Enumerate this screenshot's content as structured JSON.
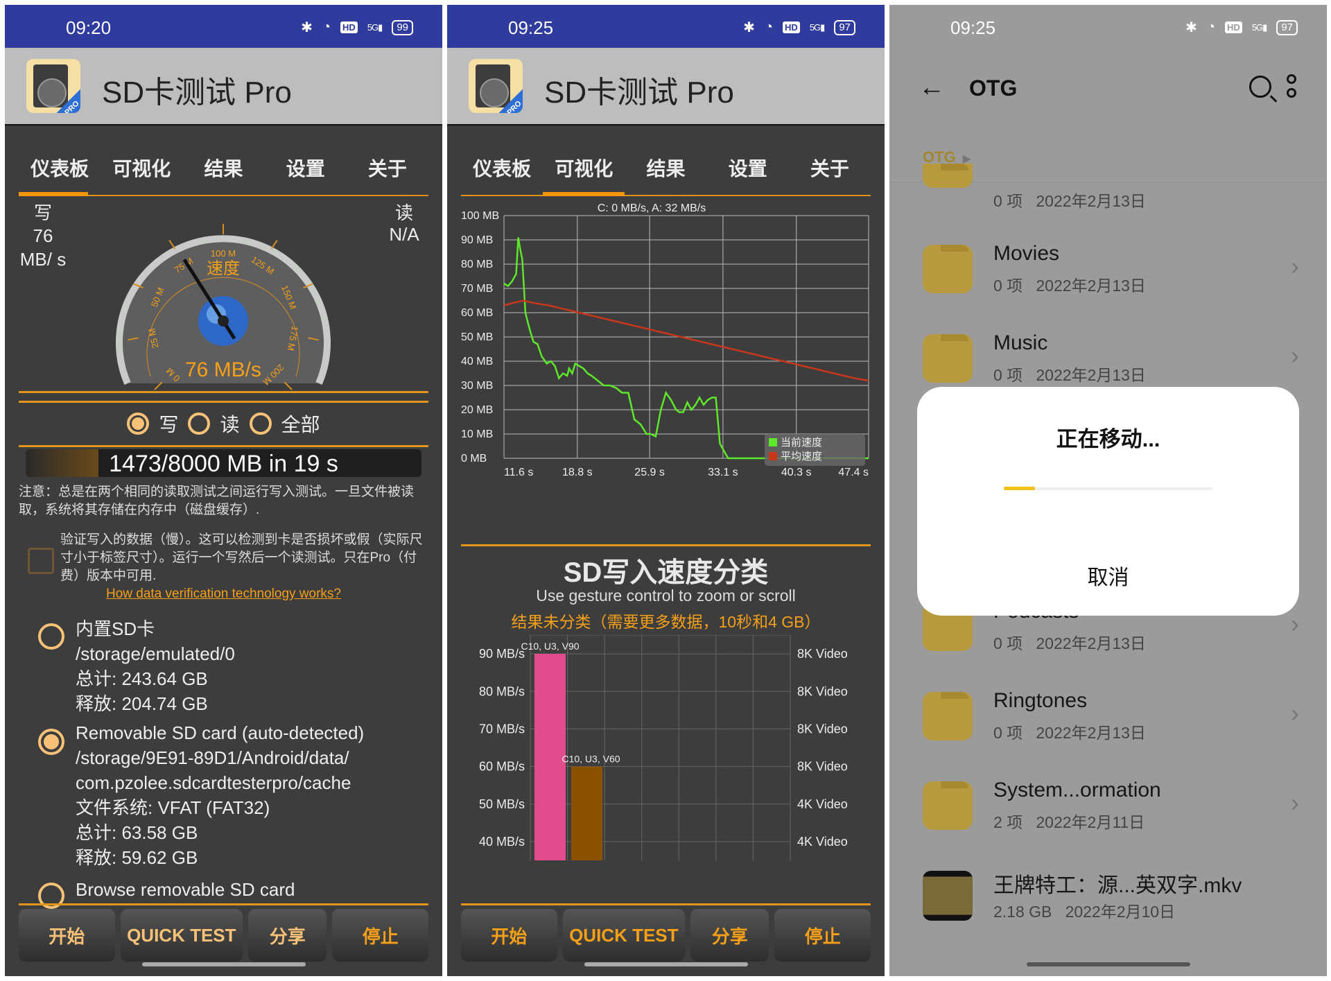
{
  "panel1": {
    "status": {
      "time": "09:20",
      "battery": "99"
    },
    "app_title": "SD卡测试 Pro",
    "icon_badge": "PRO",
    "tabs": [
      "仪表板",
      "可视化",
      "结果",
      "设置",
      "关于"
    ],
    "active_tab": 0,
    "write_label": "写",
    "write_value": "76 MB/ s",
    "read_label": "读",
    "read_value": "N/A",
    "gauge": {
      "title": "速度",
      "reading": "76 MB/s",
      "value": 76,
      "max": 200,
      "ticks": [
        "0 M",
        "25 M",
        "50 M",
        "75 M",
        "100 M",
        "125 M",
        "150 M",
        "175 M",
        "200 M"
      ]
    },
    "mode_options": [
      {
        "label": "写",
        "selected": true
      },
      {
        "label": "读",
        "selected": false
      },
      {
        "label": "全部",
        "selected": false
      }
    ],
    "progress": {
      "text": "1473/8000 MB in 19 s",
      "done_mb": 1473,
      "total_mb": 8000
    },
    "note": "注意：总是在两个相同的读取测试之间运行写入测试。一旦文件被读取，系统将其存储在内存中（磁盘缓存）.",
    "verify_text": "验证写入的数据（慢）。这可以检测到卡是否损坏或假（实际尺寸小于标签尺寸）。运行一个写然后一个读测试。只在Pro（付费）版本中可用.",
    "verify_checked": false,
    "verify_link": "How data verification technology works?",
    "storages": [
      {
        "selected": false,
        "lines": [
          "内置SD卡",
          "/storage/emulated/0",
          "总计: 243.64 GB",
          "释放: 204.74 GB"
        ]
      },
      {
        "selected": true,
        "lines": [
          "Removable SD card (auto-detected)",
          "/storage/9E91-89D1/Android/data/",
          "com.pzolee.sdcardtesterpro/cache",
          "文件系统: VFAT (FAT32)",
          "总计: 63.58 GB",
          "释放: 59.62 GB"
        ]
      },
      {
        "selected": false,
        "lines": [
          "Browse removable SD card"
        ]
      }
    ],
    "buttons": [
      "开始",
      "QUICK TEST",
      "分享",
      "停止"
    ]
  },
  "panel2": {
    "status": {
      "time": "09:25",
      "battery": "97"
    },
    "app_title": "SD卡测试 Pro",
    "icon_badge": "PRO",
    "tabs": [
      "仪表板",
      "可视化",
      "结果",
      "设置",
      "关于"
    ],
    "active_tab": 1,
    "classification": {
      "title": "SD写入速度分类",
      "subtitle": "Use gesture control to zoom or scroll",
      "warning": "结果未分类（需要更多数据，10秒和4 GB）"
    },
    "buttons": [
      "开始",
      "QUICK TEST",
      "分享",
      "停止"
    ]
  },
  "chart_data": [
    {
      "type": "line",
      "title": "C: 0 MB/s, A: 32 MB/s",
      "xlabel": "",
      "ylabel": "",
      "ylim": [
        0,
        100
      ],
      "xlim": [
        11.6,
        47.4
      ],
      "y_ticks": [
        "0 MB",
        "10 MB",
        "20 MB",
        "30 MB",
        "40 MB",
        "50 MB",
        "60 MB",
        "70 MB",
        "80 MB",
        "90 MB",
        "100 MB"
      ],
      "x_ticks": [
        "11.6 s",
        "18.8 s",
        "25.9 s",
        "33.1 s",
        "40.3 s",
        "47.4 s"
      ],
      "grid": true,
      "legend_position": "bottom-right",
      "series": [
        {
          "name": "当前速度",
          "color": "#5ee82a",
          "x": [
            11.6,
            12.0,
            12.4,
            12.8,
            13.0,
            13.2,
            13.4,
            13.7,
            14.0,
            14.2,
            14.5,
            14.9,
            15.3,
            15.8,
            16.2,
            16.6,
            17.0,
            17.4,
            17.8,
            18.0,
            18.3,
            18.6,
            19.0,
            19.4,
            19.8,
            20.2,
            20.8,
            21.4,
            22.0,
            22.6,
            23.2,
            23.8,
            24.4,
            25.0,
            25.6,
            26.0,
            26.5,
            27.0,
            27.5,
            28.0,
            28.5,
            28.8,
            29.2,
            29.6,
            30.0,
            30.4,
            30.8,
            31.2,
            31.6,
            32.0,
            32.4,
            32.8,
            33.2,
            33.6,
            34.0,
            34.4,
            34.8,
            35.2,
            35.6,
            36.0,
            36.4,
            36.8,
            40.0,
            44.0,
            47.4
          ],
          "y": [
            72,
            71,
            73,
            76,
            91,
            86,
            82,
            60,
            55,
            52,
            48,
            47,
            42,
            39,
            40,
            38,
            33,
            35,
            34,
            37,
            35,
            39,
            38,
            37,
            35,
            34,
            32,
            30,
            30,
            29,
            27,
            27,
            16,
            14,
            10,
            10,
            9,
            20,
            27,
            24,
            20,
            19,
            19,
            23,
            20,
            22,
            25,
            22,
            24,
            25,
            25,
            6,
            3,
            0,
            0,
            0,
            0,
            0,
            0,
            0,
            0,
            0,
            0,
            0,
            0
          ]
        },
        {
          "name": "平均速度",
          "color": "#c8371a",
          "x": [
            11.6,
            12.5,
            13.5,
            14.5,
            16,
            18,
            20,
            22,
            24,
            26,
            28,
            30,
            32,
            34,
            36,
            38,
            40,
            42,
            44,
            46,
            47.4
          ],
          "y": [
            63,
            64,
            65,
            64,
            63,
            61,
            59,
            57,
            55,
            53,
            51,
            49,
            47,
            45,
            43,
            41,
            39,
            37,
            35,
            33,
            32
          ]
        }
      ]
    },
    {
      "type": "bar",
      "title": "SD写入速度分类",
      "ylim": [
        35,
        95
      ],
      "y_ticks_left": [
        "40 MB/s",
        "50 MB/s",
        "60 MB/s",
        "70 MB/s",
        "80 MB/s",
        "90 MB/s"
      ],
      "y_ticks_right": [
        "4K Video",
        "4K Video",
        "8K Video",
        "8K Video",
        "8K Video",
        "8K Video"
      ],
      "grid": true,
      "categories": [
        "C10, U3, V90",
        "C10, U3, V60"
      ],
      "values": [
        90,
        60
      ],
      "colors": [
        "#e04c8c",
        "#8a5200"
      ]
    }
  ],
  "panel3": {
    "status": {
      "time": "09:25",
      "battery": "97"
    },
    "title": "OTG",
    "breadcrumb": "OTG",
    "items": [
      {
        "name": "",
        "meta_count": "0 项",
        "meta_date": "2022年2月13日",
        "type": "folder"
      },
      {
        "name": "Movies",
        "meta_count": "0 项",
        "meta_date": "2022年2月13日",
        "type": "folder"
      },
      {
        "name": "Music",
        "meta_count": "0 项",
        "meta_date": "2022年2月13日",
        "type": "folder"
      },
      {
        "name": "Podcasts",
        "meta_count": "0 项",
        "meta_date": "2022年2月13日",
        "type": "folder"
      },
      {
        "name": "Ringtones",
        "meta_count": "0 项",
        "meta_date": "2022年2月13日",
        "type": "folder"
      },
      {
        "name": "System...ormation",
        "meta_count": "2 项",
        "meta_date": "2022年2月11日",
        "type": "folder"
      },
      {
        "name": "王牌特工：源...英双字.mkv",
        "meta_count": "2.18 GB",
        "meta_date": "2022年2月10日",
        "type": "video"
      }
    ],
    "dialog": {
      "title": "正在移动...",
      "cancel": "取消",
      "progress": 0.15
    }
  }
}
